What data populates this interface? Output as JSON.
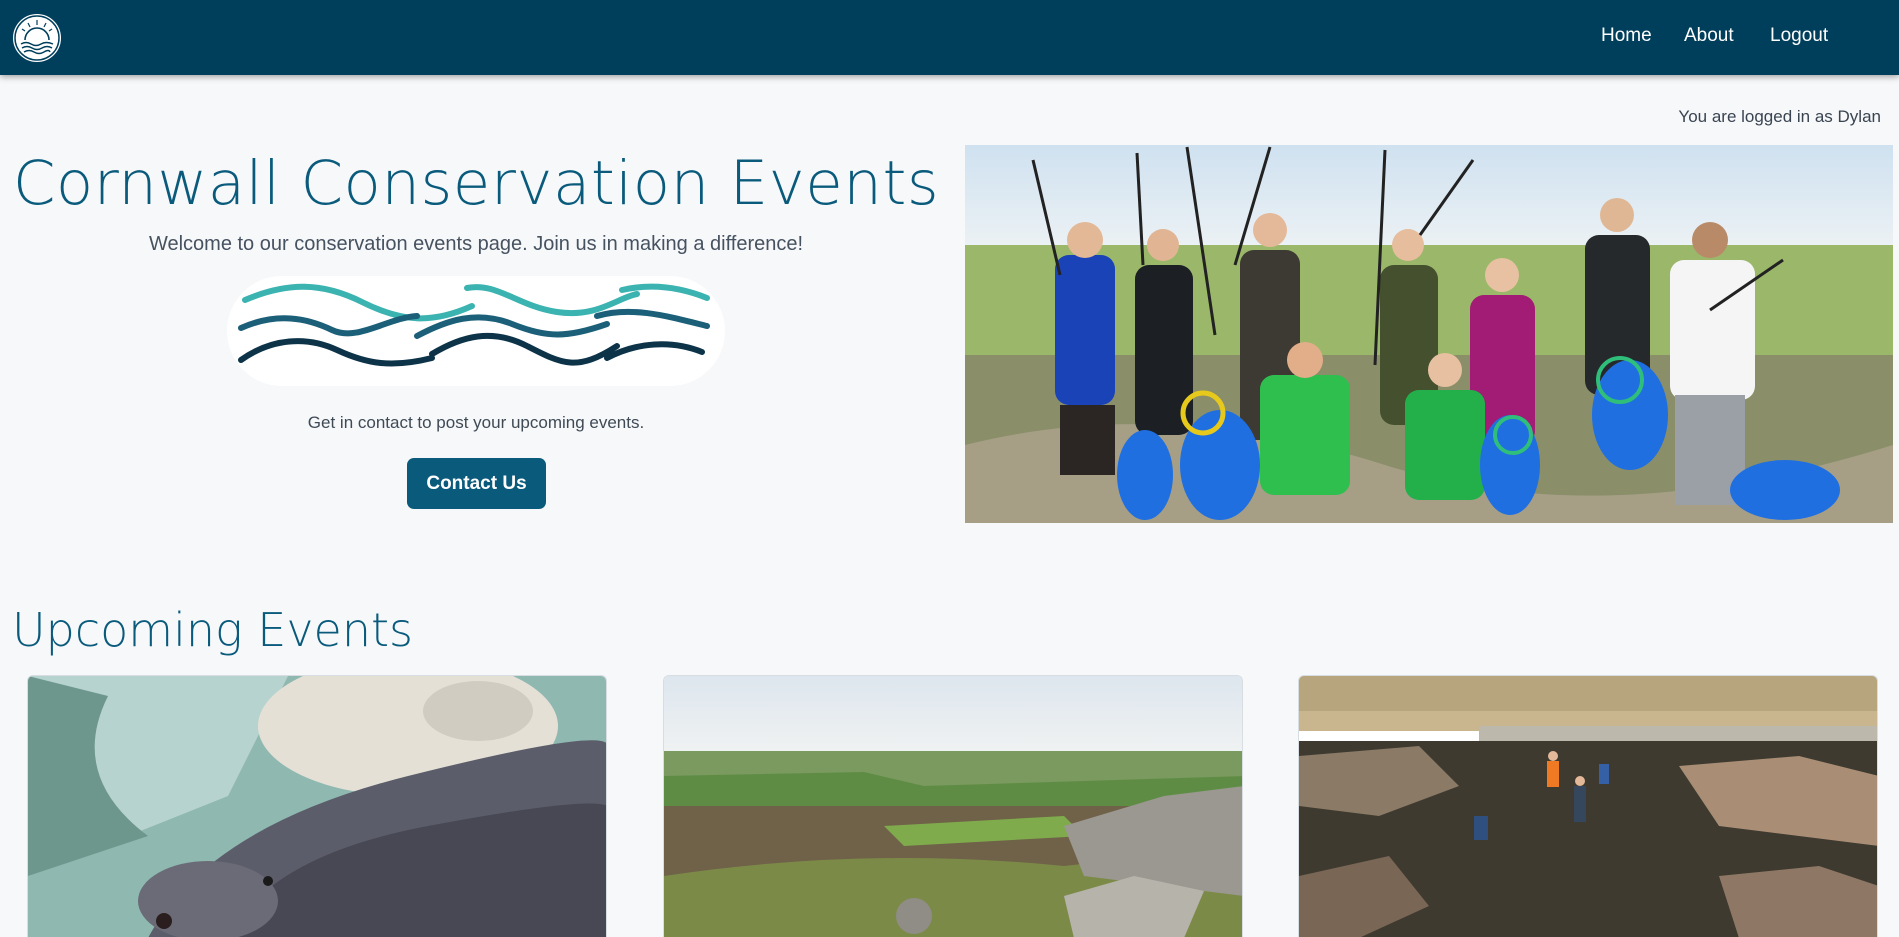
{
  "nav": {
    "logo_alt": "Sea and sun logo",
    "links": [
      {
        "label": "Home"
      },
      {
        "label": "About"
      },
      {
        "label": "Logout"
      }
    ]
  },
  "user": {
    "status": "You are logged in as Dylan"
  },
  "hero": {
    "title": "Cornwall Conservation Events",
    "subtitle": "Welcome to our conservation events page. Join us in making a difference!",
    "contact_note": "Get in contact to post your upcoming events.",
    "contact_button": "Contact Us",
    "image_icon": "volunteer-group-photo"
  },
  "events": {
    "title": "Upcoming Events",
    "cards": [
      {
        "image_icon": "seal-photo"
      },
      {
        "image_icon": "moorland-photo"
      },
      {
        "image_icon": "rocky-shore-photo"
      }
    ]
  },
  "colors": {
    "navbar": "#003f5c",
    "accent": "#0a5a7c",
    "background": "#f6f8fa",
    "wave_teal": "#3bb3b0",
    "wave_mid": "#1b5f78",
    "wave_dark": "#0d3349"
  }
}
